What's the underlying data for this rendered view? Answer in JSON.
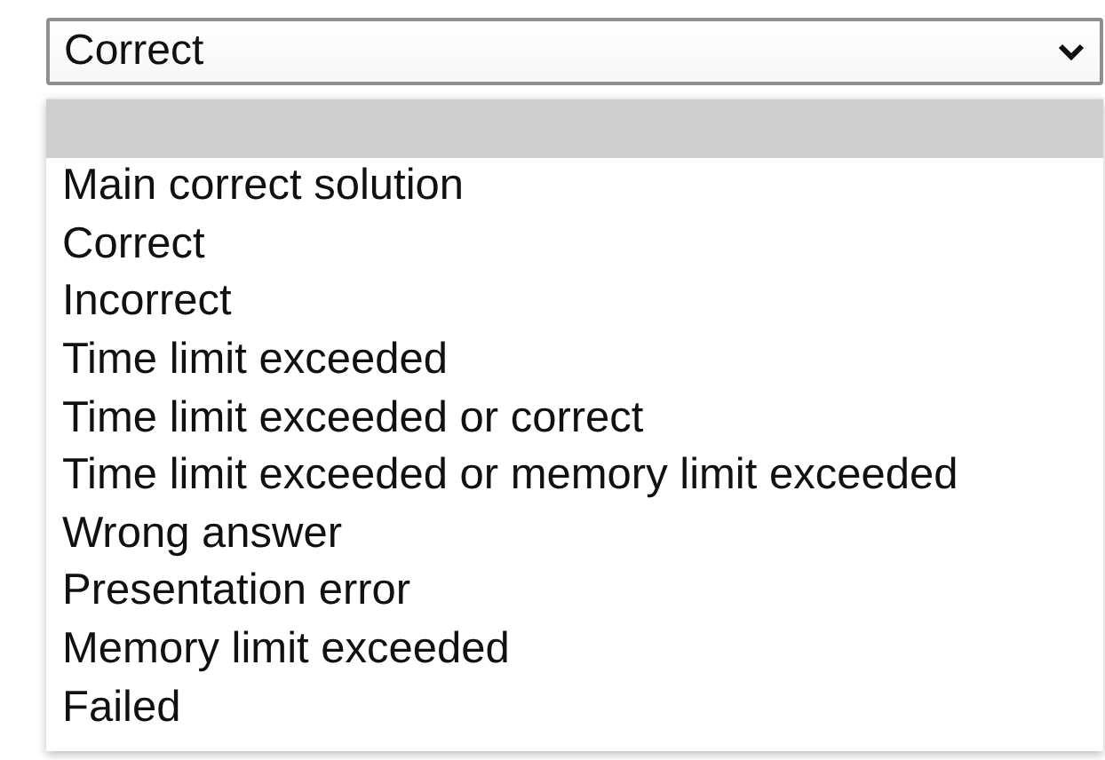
{
  "select": {
    "value": "Correct"
  },
  "options": [
    {
      "selected": true
    },
    {
      "label": "Main correct solution",
      "selected": false
    },
    {
      "label": "Correct",
      "selected": false
    },
    {
      "label": "Incorrect",
      "selected": false
    },
    {
      "label": "Time limit exceeded",
      "selected": false
    },
    {
      "label": "Time limit exceeded or correct",
      "selected": false
    },
    {
      "label": "Time limit exceeded or memory limit exceeded",
      "selected": false
    },
    {
      "label": "Wrong answer",
      "selected": false
    },
    {
      "label": "Presentation error",
      "selected": false
    },
    {
      "label": "Memory limit exceeded",
      "selected": false
    },
    {
      "label": "Failed",
      "selected": false
    }
  ]
}
